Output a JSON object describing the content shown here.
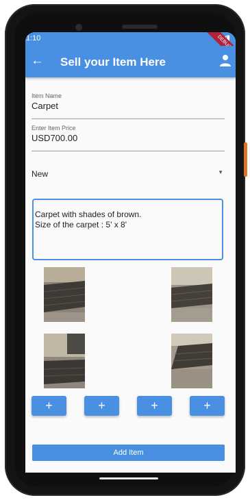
{
  "status_bar": {
    "time": "1:10",
    "debug_label": "DEBUG"
  },
  "app_bar": {
    "title": "Sell your Item Here",
    "back_icon": "arrow-back-icon",
    "profile_icon": "person-icon",
    "accent": "#4a90e2"
  },
  "form": {
    "item_name": {
      "label": "Item Name",
      "value": "Carpet"
    },
    "item_price": {
      "label": "Enter Item Price",
      "value": "USD700.00"
    },
    "condition": {
      "value": "New"
    },
    "description": {
      "line1": "Carpet with shades of brown.",
      "line2": "Size of the carpet : 5' x 8'"
    }
  },
  "images": [
    {
      "name": "carpet-photo-1"
    },
    {
      "name": "carpet-photo-2"
    },
    {
      "name": "carpet-photo-3"
    },
    {
      "name": "carpet-photo-4"
    }
  ],
  "add_image_buttons": [
    "+",
    "+",
    "+",
    "+"
  ],
  "submit": {
    "label": "Add Item"
  }
}
